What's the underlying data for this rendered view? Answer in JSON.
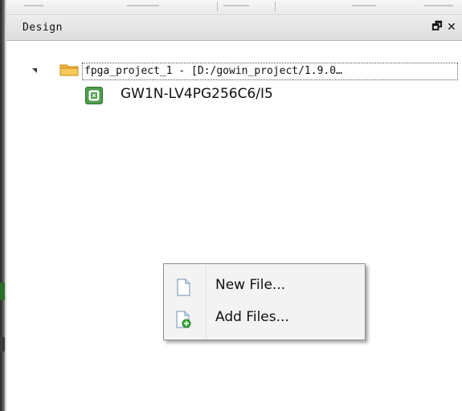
{
  "panel": {
    "title": "Design",
    "float_icon": "restore-window-icon",
    "close_icon": "close-icon",
    "float_glyph": "🗗",
    "close_glyph": "✕"
  },
  "tree": {
    "project": {
      "label": "fpga_project_1 - [D:/gowin_project/1.9.0…",
      "icon": "folder-icon",
      "expanded": true
    },
    "device": {
      "label": "GW1N-LV4PG256C6/I5",
      "icon": "device-chip-icon"
    }
  },
  "context_menu": {
    "items": [
      {
        "label": "New File...",
        "icon": "new-file-icon"
      },
      {
        "label": "Add Files...",
        "icon": "add-files-icon"
      }
    ]
  },
  "colors": {
    "folder": "#f0b640",
    "device_icon": "#4e9e4b",
    "add_badge": "#39a839"
  }
}
